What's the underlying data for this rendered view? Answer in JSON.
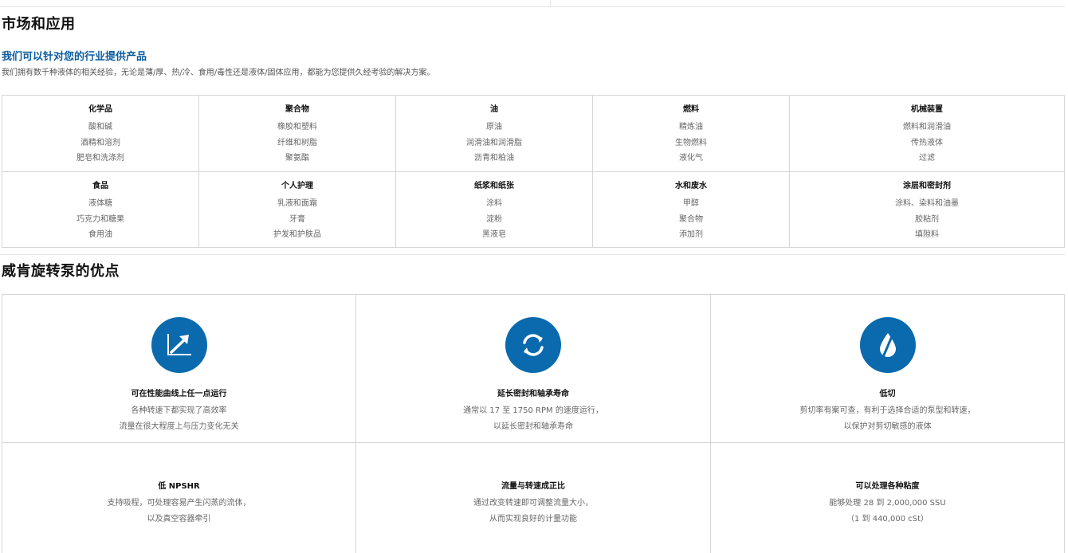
{
  "markets": {
    "title": "市场和应用",
    "subheading": "我们可以针对您的行业提供产品",
    "intro": "我们拥有数千种液体的相关经验，无论是薄/厚、热/冷、食用/毒性还是液体/固体应用，都能为您提供久经考验的解决方案。",
    "categories": [
      {
        "title": "化学品",
        "items": [
          "酸和碱",
          "酒精和溶剂",
          "肥皂和洗涤剂"
        ]
      },
      {
        "title": "聚合物",
        "items": [
          "橡胶和塑料",
          "纤维和树脂",
          "聚氨酯"
        ]
      },
      {
        "title": "油",
        "items": [
          "原油",
          "润滑油和润滑脂",
          "沥青和柏油"
        ]
      },
      {
        "title": "燃料",
        "items": [
          "精炼油",
          "生物燃料",
          "液化气"
        ]
      },
      {
        "title": "机械装置",
        "items": [
          "燃料和润滑油",
          "传热液体",
          "过滤"
        ]
      },
      {
        "title": "食品",
        "items": [
          "液体糖",
          "巧克力和糖果",
          "食用油"
        ]
      },
      {
        "title": "个人护理",
        "items": [
          "乳液和面霜",
          "牙膏",
          "护发和护肤品"
        ]
      },
      {
        "title": "纸浆和纸张",
        "items": [
          "涂料",
          "淀粉",
          "黑液皂"
        ]
      },
      {
        "title": "水和废水",
        "items": [
          "甲醇",
          "聚合物",
          "添加剂"
        ]
      },
      {
        "title": "涂层和密封剂",
        "items": [
          "涂料、染料和油墨",
          "胶粘剂",
          "填隙料"
        ]
      }
    ]
  },
  "advantages": {
    "title": "威肯旋转泵的优点",
    "icon_color": "#0a6aad",
    "items": [
      {
        "icon": "performance-curve-icon",
        "title": "可在性能曲线上任一点运行",
        "lines": [
          "各种转速下都实现了高效率",
          "流量在很大程度上与压力变化无关"
        ]
      },
      {
        "icon": "rotation-cycle-icon",
        "title": "延长密封和轴承寿命",
        "lines": [
          "通常以 17 至 1750 RPM 的速度运行，",
          "以延长密封和轴承寿命"
        ]
      },
      {
        "icon": "low-shear-drop-icon",
        "title": "低切",
        "lines": [
          "剪切率有案可查，有利于选择合适的泵型和转速，",
          "以保护对剪切敏感的液体"
        ]
      },
      {
        "title": "低 NPSHR",
        "lines": [
          "支持吸程，可处理容易产生闪蒸的流体，",
          "以及真空容器牵引"
        ]
      },
      {
        "title": "流量与转速成正比",
        "lines": [
          "通过改变转速即可调整流量大小，",
          "从而实现良好的计量功能"
        ]
      },
      {
        "title": "可以处理各种粘度",
        "lines": [
          "能够处理 28 到 2,000,000 SSU",
          "（1 到 440,000 cSt）"
        ]
      }
    ]
  }
}
